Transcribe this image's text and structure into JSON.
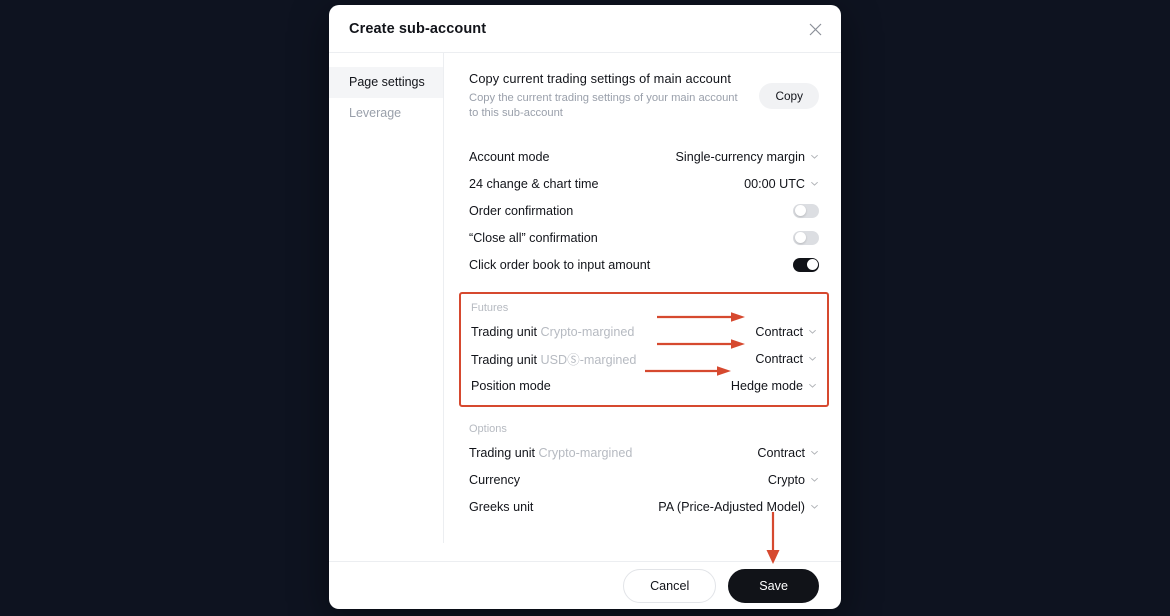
{
  "window": {
    "background_color": "#0e1320"
  },
  "modal": {
    "title": "Create sub-account",
    "close_icon": "close-icon"
  },
  "sidebar": {
    "items": [
      {
        "label": "Page settings",
        "active": true
      },
      {
        "label": "Leverage",
        "active": false
      }
    ]
  },
  "copy_block": {
    "title": "Copy current trading settings of main account",
    "subtitle": "Copy the current trading settings of your main account to this sub-account",
    "button_label": "Copy"
  },
  "general_rows": [
    {
      "label": "Account mode",
      "value": "Single-currency margin",
      "control": "dropdown"
    },
    {
      "label": "24 change & chart time",
      "value": "00:00 UTC",
      "control": "dropdown"
    },
    {
      "label": "Order confirmation",
      "value": "off",
      "control": "toggle"
    },
    {
      "label": "“Close all” confirmation",
      "value": "off",
      "control": "toggle"
    },
    {
      "label": "Click order book to input amount",
      "value": "on",
      "control": "toggle"
    }
  ],
  "futures": {
    "group_label": "Futures",
    "rows": [
      {
        "label": "Trading unit",
        "label_muted": "Crypto-margined",
        "value": "Contract",
        "control": "dropdown",
        "arrow": true
      },
      {
        "label": "Trading unit",
        "label_muted": "USDⓈ-margined",
        "value": "Contract",
        "control": "dropdown",
        "arrow": true
      },
      {
        "label": "Position mode",
        "label_muted": "",
        "value": "Hedge mode",
        "control": "dropdown",
        "arrow": true
      }
    ]
  },
  "options": {
    "group_label": "Options",
    "rows": [
      {
        "label": "Trading unit",
        "label_muted": "Crypto-margined",
        "value": "Contract",
        "control": "dropdown"
      },
      {
        "label": "Currency",
        "label_muted": "",
        "value": "Crypto",
        "control": "dropdown"
      },
      {
        "label": "Greeks unit",
        "label_muted": "",
        "value": "PA (Price-Adjusted Model)",
        "control": "dropdown"
      }
    ]
  },
  "footer": {
    "cancel_label": "Cancel",
    "save_label": "Save"
  },
  "annotations": {
    "highlight_color": "#d6492f",
    "arrow_color": "#d6492f",
    "vertical_arrow_target": "Save"
  }
}
